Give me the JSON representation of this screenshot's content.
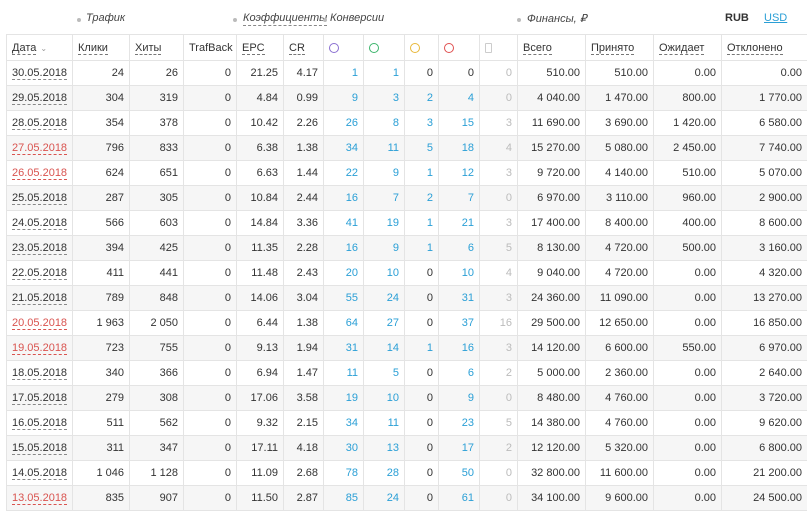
{
  "groups": {
    "traffic": "Трафик",
    "coefficients": "Коэффициенты",
    "conversions": "Конверсии",
    "finance": "Финансы, ₽"
  },
  "currency": {
    "rub": "RUB",
    "usd": "USD"
  },
  "headers": {
    "date": "Дата",
    "clicks": "Клики",
    "hits": "Хиты",
    "trafback": "TrafBack",
    "epc": "EPC",
    "cr": "CR",
    "total": "Всего",
    "accepted": "Принято",
    "pending": "Ожидает",
    "rejected": "Отклонено"
  },
  "conversion_icons": [
    "hold-icon",
    "approved-icon",
    "pending-icon",
    "rejected-icon",
    "trash-icon"
  ],
  "rows": [
    {
      "date": "30.05.2018",
      "weekend": false,
      "clicks": "24",
      "hits": "26",
      "trafback": "0",
      "epc": "21.25",
      "cr": "4.17",
      "c1": "1",
      "c2": "1",
      "c3": "0",
      "c4": "0",
      "c5": "0",
      "total": "510.00",
      "accepted": "510.00",
      "pending": "0.00",
      "rejected": "0.00"
    },
    {
      "date": "29.05.2018",
      "weekend": false,
      "clicks": "304",
      "hits": "319",
      "trafback": "0",
      "epc": "4.84",
      "cr": "0.99",
      "c1": "9",
      "c2": "3",
      "c3": "2",
      "c4": "4",
      "c5": "0",
      "total": "4 040.00",
      "accepted": "1 470.00",
      "pending": "800.00",
      "rejected": "1 770.00"
    },
    {
      "date": "28.05.2018",
      "weekend": false,
      "clicks": "354",
      "hits": "378",
      "trafback": "0",
      "epc": "10.42",
      "cr": "2.26",
      "c1": "26",
      "c2": "8",
      "c3": "3",
      "c4": "15",
      "c5": "3",
      "total": "11 690.00",
      "accepted": "3 690.00",
      "pending": "1 420.00",
      "rejected": "6 580.00"
    },
    {
      "date": "27.05.2018",
      "weekend": true,
      "clicks": "796",
      "hits": "833",
      "trafback": "0",
      "epc": "6.38",
      "cr": "1.38",
      "c1": "34",
      "c2": "11",
      "c3": "5",
      "c4": "18",
      "c5": "4",
      "total": "15 270.00",
      "accepted": "5 080.00",
      "pending": "2 450.00",
      "rejected": "7 740.00"
    },
    {
      "date": "26.05.2018",
      "weekend": true,
      "clicks": "624",
      "hits": "651",
      "trafback": "0",
      "epc": "6.63",
      "cr": "1.44",
      "c1": "22",
      "c2": "9",
      "c3": "1",
      "c4": "12",
      "c5": "3",
      "total": "9 720.00",
      "accepted": "4 140.00",
      "pending": "510.00",
      "rejected": "5 070.00"
    },
    {
      "date": "25.05.2018",
      "weekend": false,
      "clicks": "287",
      "hits": "305",
      "trafback": "0",
      "epc": "10.84",
      "cr": "2.44",
      "c1": "16",
      "c2": "7",
      "c3": "2",
      "c4": "7",
      "c5": "0",
      "total": "6 970.00",
      "accepted": "3 110.00",
      "pending": "960.00",
      "rejected": "2 900.00"
    },
    {
      "date": "24.05.2018",
      "weekend": false,
      "clicks": "566",
      "hits": "603",
      "trafback": "0",
      "epc": "14.84",
      "cr": "3.36",
      "c1": "41",
      "c2": "19",
      "c3": "1",
      "c4": "21",
      "c5": "3",
      "total": "17 400.00",
      "accepted": "8 400.00",
      "pending": "400.00",
      "rejected": "8 600.00"
    },
    {
      "date": "23.05.2018",
      "weekend": false,
      "clicks": "394",
      "hits": "425",
      "trafback": "0",
      "epc": "11.35",
      "cr": "2.28",
      "c1": "16",
      "c2": "9",
      "c3": "1",
      "c4": "6",
      "c5": "5",
      "total": "8 130.00",
      "accepted": "4 720.00",
      "pending": "500.00",
      "rejected": "3 160.00"
    },
    {
      "date": "22.05.2018",
      "weekend": false,
      "clicks": "411",
      "hits": "441",
      "trafback": "0",
      "epc": "11.48",
      "cr": "2.43",
      "c1": "20",
      "c2": "10",
      "c3": "0",
      "c4": "10",
      "c5": "4",
      "total": "9 040.00",
      "accepted": "4 720.00",
      "pending": "0.00",
      "rejected": "4 320.00"
    },
    {
      "date": "21.05.2018",
      "weekend": false,
      "clicks": "789",
      "hits": "848",
      "trafback": "0",
      "epc": "14.06",
      "cr": "3.04",
      "c1": "55",
      "c2": "24",
      "c3": "0",
      "c4": "31",
      "c5": "3",
      "total": "24 360.00",
      "accepted": "11 090.00",
      "pending": "0.00",
      "rejected": "13 270.00"
    },
    {
      "date": "20.05.2018",
      "weekend": true,
      "clicks": "1 963",
      "hits": "2 050",
      "trafback": "0",
      "epc": "6.44",
      "cr": "1.38",
      "c1": "64",
      "c2": "27",
      "c3": "0",
      "c4": "37",
      "c5": "16",
      "total": "29 500.00",
      "accepted": "12 650.00",
      "pending": "0.00",
      "rejected": "16 850.00"
    },
    {
      "date": "19.05.2018",
      "weekend": true,
      "clicks": "723",
      "hits": "755",
      "trafback": "0",
      "epc": "9.13",
      "cr": "1.94",
      "c1": "31",
      "c2": "14",
      "c3": "1",
      "c4": "16",
      "c5": "3",
      "total": "14 120.00",
      "accepted": "6 600.00",
      "pending": "550.00",
      "rejected": "6 970.00"
    },
    {
      "date": "18.05.2018",
      "weekend": false,
      "clicks": "340",
      "hits": "366",
      "trafback": "0",
      "epc": "6.94",
      "cr": "1.47",
      "c1": "11",
      "c2": "5",
      "c3": "0",
      "c4": "6",
      "c5": "2",
      "total": "5 000.00",
      "accepted": "2 360.00",
      "pending": "0.00",
      "rejected": "2 640.00"
    },
    {
      "date": "17.05.2018",
      "weekend": false,
      "clicks": "279",
      "hits": "308",
      "trafback": "0",
      "epc": "17.06",
      "cr": "3.58",
      "c1": "19",
      "c2": "10",
      "c3": "0",
      "c4": "9",
      "c5": "0",
      "total": "8 480.00",
      "accepted": "4 760.00",
      "pending": "0.00",
      "rejected": "3 720.00"
    },
    {
      "date": "16.05.2018",
      "weekend": false,
      "clicks": "511",
      "hits": "562",
      "trafback": "0",
      "epc": "9.32",
      "cr": "2.15",
      "c1": "34",
      "c2": "11",
      "c3": "0",
      "c4": "23",
      "c5": "5",
      "total": "14 380.00",
      "accepted": "4 760.00",
      "pending": "0.00",
      "rejected": "9 620.00"
    },
    {
      "date": "15.05.2018",
      "weekend": false,
      "clicks": "311",
      "hits": "347",
      "trafback": "0",
      "epc": "17.11",
      "cr": "4.18",
      "c1": "30",
      "c2": "13",
      "c3": "0",
      "c4": "17",
      "c5": "2",
      "total": "12 120.00",
      "accepted": "5 320.00",
      "pending": "0.00",
      "rejected": "6 800.00"
    },
    {
      "date": "14.05.2018",
      "weekend": false,
      "clicks": "1 046",
      "hits": "1 128",
      "trafback": "0",
      "epc": "11.09",
      "cr": "2.68",
      "c1": "78",
      "c2": "28",
      "c3": "0",
      "c4": "50",
      "c5": "0",
      "total": "32 800.00",
      "accepted": "11 600.00",
      "pending": "0.00",
      "rejected": "21 200.00"
    },
    {
      "date": "13.05.2018",
      "weekend": true,
      "clicks": "835",
      "hits": "907",
      "trafback": "0",
      "epc": "11.50",
      "cr": "2.87",
      "c1": "85",
      "c2": "24",
      "c3": "0",
      "c4": "61",
      "c5": "0",
      "total": "34 100.00",
      "accepted": "9 600.00",
      "pending": "0.00",
      "rejected": "24 500.00"
    }
  ]
}
